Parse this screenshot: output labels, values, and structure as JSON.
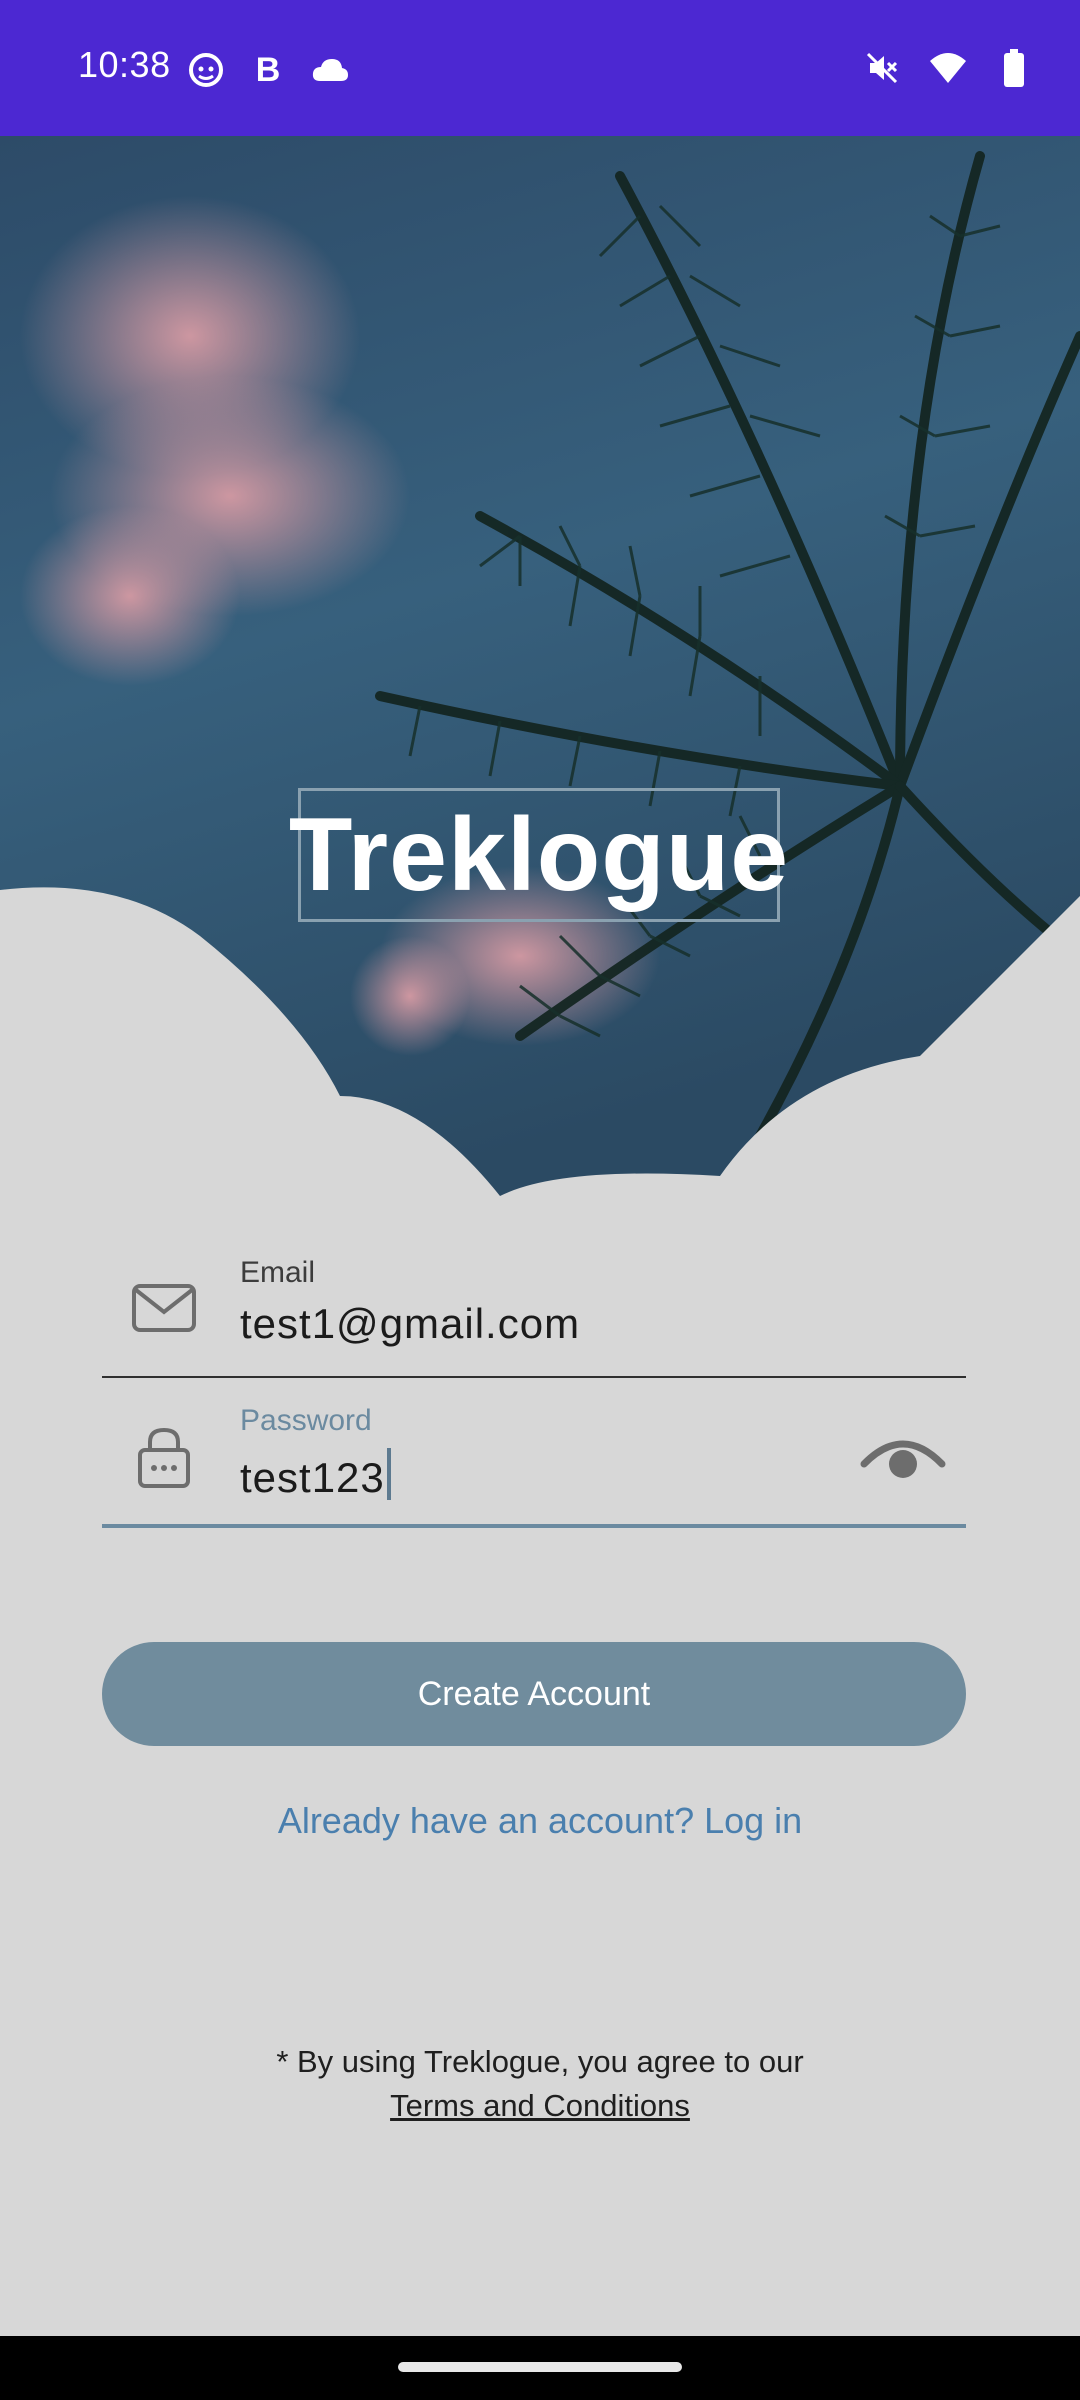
{
  "status_bar": {
    "time": "10:38",
    "left_icons": [
      "face-notification-icon",
      "bold-b-icon",
      "cloud-icon"
    ],
    "right_icons": [
      "mute-icon",
      "wifi-icon",
      "battery-icon"
    ],
    "bold_glyph": "B"
  },
  "hero": {
    "app_title": "Treklogue"
  },
  "form": {
    "email": {
      "label": "Email",
      "value": "test1@gmail.com",
      "icon": "mail-icon"
    },
    "password": {
      "label": "Password",
      "value": "test123",
      "icon": "lock-icon",
      "toggle_icon": "eye-icon"
    }
  },
  "actions": {
    "create_account": "Create Account",
    "login_link": "Already have an account? Log in"
  },
  "terms": {
    "prefix": "* By using Treklogue, you agree to our",
    "link": "Terms and Conditions"
  },
  "colors": {
    "status_bar": "#4c28d2",
    "background": "#d7d7d7",
    "button": "#708c9d",
    "link": "#4a7fae"
  }
}
